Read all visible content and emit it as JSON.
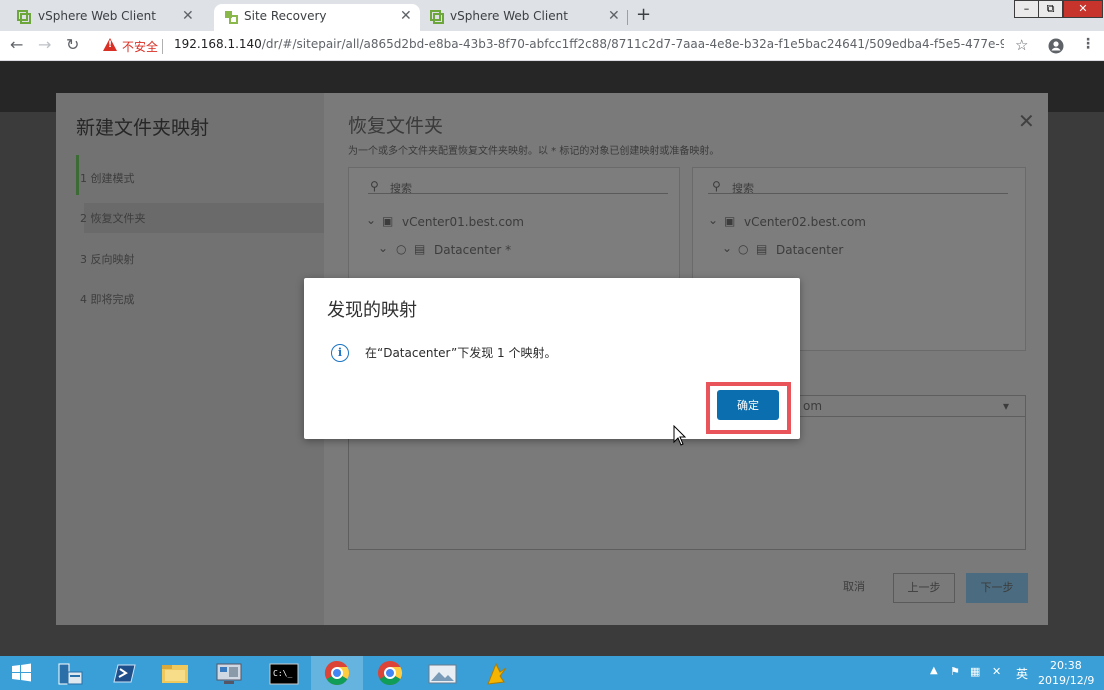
{
  "browser": {
    "tabs": [
      {
        "title": "vSphere Web Client",
        "active": false
      },
      {
        "title": "Site Recovery",
        "active": true
      },
      {
        "title": "vSphere Web Client",
        "active": false
      }
    ],
    "new_tab_label": "+",
    "window_controls": {
      "minimize": "–",
      "maximize": "⧉",
      "close": "✕"
    },
    "address": {
      "security_label": "不安全",
      "host": "192.168.1.140",
      "path": "/dr/#/sitepair/all/a865d2bd-e8ba-43b3-8f70-abfcc1ff2c88/8711c2d7-7aaa-4e8e-b32a-f1e5bac24641/509edba4-f5e5-477e-953..."
    }
  },
  "wizard": {
    "title": "新建文件夹映射",
    "steps": [
      "1  创建模式",
      "2  恢复文件夹",
      "3  反向映射",
      "4  即将完成"
    ],
    "section_title": "恢复文件夹",
    "section_subtitle": "为一个或多个文件夹配置恢复文件夹映射。以 * 标记的对象已创建映射或准备映射。",
    "left_pane": {
      "search_placeholder": "搜索",
      "vcenter": "vCenter01.best.com",
      "datacenter": "Datacenter *"
    },
    "right_pane": {
      "search_placeholder": "搜索",
      "vcenter": "vCenter02.best.com",
      "datacenter": "Datacenter"
    },
    "dropdown_partial": "om",
    "buttons": {
      "cancel": "取消",
      "back": "上一步",
      "next": "下一步"
    }
  },
  "dialog": {
    "title": "发现的映射",
    "message": "在“Datacenter”下发现 1 个映射。",
    "ok_label": "确定",
    "info_icon": "i"
  },
  "taskbar": {
    "time": "20:38",
    "date": "2019/12/9",
    "ime": "英",
    "apps": [
      "server-manager",
      "powershell",
      "file-explorer",
      "remote-desktop",
      "cmd",
      "chrome",
      "chrome",
      "photo-viewer",
      "unknown-app"
    ]
  },
  "colors": {
    "accent": "#0a6eaf",
    "highlight": "#e8545a",
    "taskbar": "#3a9fd6"
  }
}
